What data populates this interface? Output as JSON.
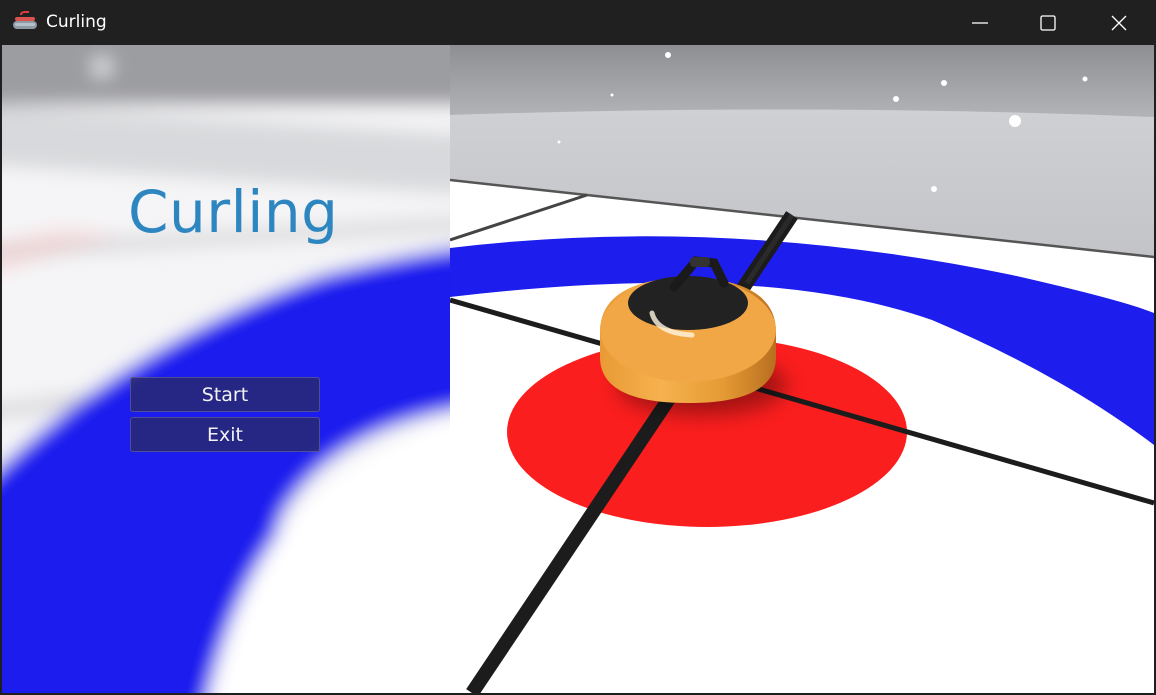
{
  "window": {
    "title": "Curling",
    "icon": "curling-stone-icon",
    "controls": [
      "minimize-icon",
      "maximize-icon",
      "close-icon"
    ]
  },
  "menu": {
    "title": "Curling",
    "title_color": "#2e86c1",
    "buttons": [
      {
        "label": "Start"
      },
      {
        "label": "Exit"
      }
    ]
  },
  "scene": {
    "description_colors": {
      "ice": "#ffffff",
      "house_blue": "#1f1ff0",
      "button_red": "#ff1e1e",
      "stone_body": "#f0a040",
      "stone_top": "#222222",
      "wall": "#c8c9cd"
    }
  }
}
